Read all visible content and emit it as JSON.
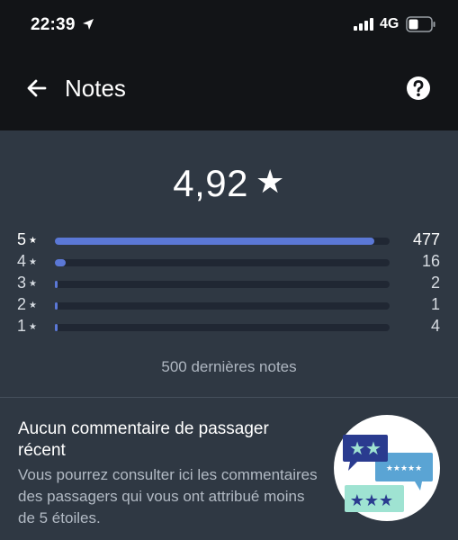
{
  "status_bar": {
    "time": "22:39",
    "network": "4G"
  },
  "header": {
    "title": "Notes",
    "back_icon": "back-arrow-icon",
    "help_icon": "help-icon"
  },
  "rating": {
    "value": "4,92",
    "star": "★"
  },
  "breakdown": [
    {
      "stars": "5",
      "count": "477",
      "fraction": 0.954
    },
    {
      "stars": "4",
      "count": "16",
      "fraction": 0.032
    },
    {
      "stars": "3",
      "count": "2",
      "fraction": 0.004
    },
    {
      "stars": "2",
      "count": "1",
      "fraction": 0.002
    },
    {
      "stars": "1",
      "count": "4",
      "fraction": 0.008
    }
  ],
  "summary": "500 dernières notes",
  "comments": {
    "title": "Aucun commentaire de passager récent",
    "body": "Vous pourrez consulter ici les commentaires des passagers qui vous ont attribué moins de 5 étoiles."
  },
  "colors": {
    "header_bg": "#121417",
    "page_bg": "#2f3843",
    "bar_fill": "#5b78d6",
    "bar_track": "#202733"
  }
}
